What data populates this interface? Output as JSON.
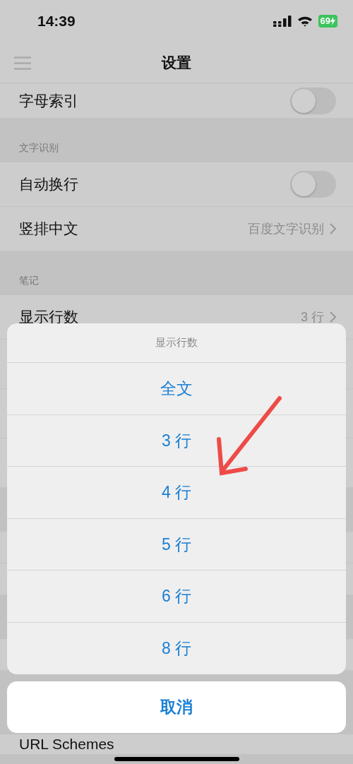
{
  "status_bar": {
    "time": "14:39",
    "battery": "69"
  },
  "nav": {
    "title": "设置"
  },
  "settings": [
    {
      "kind": "toggle",
      "label": "字母索引",
      "on": false
    },
    {
      "kind": "header",
      "label": "文字识别"
    },
    {
      "kind": "toggle",
      "label": "自动换行",
      "on": false
    },
    {
      "kind": "link",
      "label": "竖排中文",
      "value": "百度文字识别"
    },
    {
      "kind": "header",
      "label": "笔记"
    },
    {
      "kind": "link",
      "label": "显示行数",
      "value": "3 行"
    },
    {
      "kind": "blank"
    },
    {
      "kind": "blank"
    },
    {
      "kind": "blank"
    },
    {
      "kind": "header"
    },
    {
      "kind": "blank"
    },
    {
      "kind": "blank"
    },
    {
      "kind": "header"
    },
    {
      "kind": "blank"
    },
    {
      "kind": "plain",
      "label": "URL Schemes"
    }
  ],
  "action_sheet": {
    "title": "显示行数",
    "options": [
      "全文",
      "3 行",
      "4 行",
      "5 行",
      "6 行",
      "8 行"
    ],
    "cancel": "取消"
  }
}
